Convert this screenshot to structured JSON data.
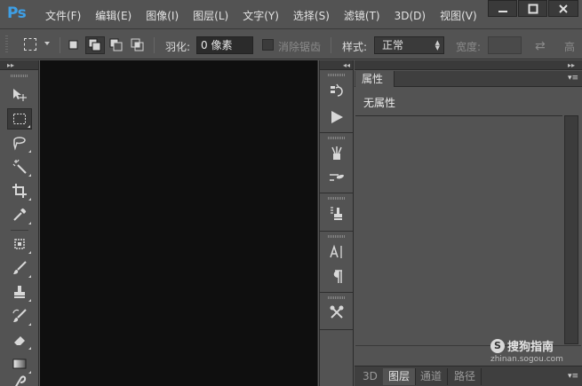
{
  "app": {
    "logo": "Ps"
  },
  "menu": [
    {
      "label": "文件(F)"
    },
    {
      "label": "编辑(E)"
    },
    {
      "label": "图像(I)"
    },
    {
      "label": "图层(L)"
    },
    {
      "label": "文字(Y)"
    },
    {
      "label": "选择(S)"
    },
    {
      "label": "滤镜(T)"
    },
    {
      "label": "3D(D)"
    },
    {
      "label": "视图(V)"
    }
  ],
  "window_controls": {
    "minimize": "—",
    "maximize": "□",
    "close": "✕"
  },
  "options_bar": {
    "feather_label": "羽化:",
    "feather_value": "0 像素",
    "antialias_label": "消除锯齿",
    "style_label": "样式:",
    "style_value": "正常",
    "width_label": "宽度:",
    "height_label": "高"
  },
  "tools": [
    {
      "icon": "move-icon"
    },
    {
      "icon": "rectangular-marquee-icon",
      "active": true
    },
    {
      "icon": "lasso-icon"
    },
    {
      "icon": "magic-wand-icon"
    },
    {
      "icon": "crop-icon"
    },
    {
      "icon": "eyedropper-icon"
    },
    {
      "icon": "spot-healing-brush-icon"
    },
    {
      "icon": "brush-icon"
    },
    {
      "icon": "clone-stamp-icon"
    },
    {
      "icon": "history-brush-icon"
    },
    {
      "icon": "eraser-icon"
    },
    {
      "icon": "gradient-icon"
    },
    {
      "icon": "smudge-icon"
    }
  ],
  "mini_panels": [
    {
      "icon": "history-panel-icon"
    },
    {
      "icon": "actions-play-icon"
    },
    {
      "icon": "brush-presets-icon"
    },
    {
      "icon": "brush-settings-icon"
    },
    {
      "icon": "clone-source-icon"
    },
    {
      "icon": "character-panel-icon"
    },
    {
      "icon": "paragraph-panel-icon"
    },
    {
      "icon": "tool-presets-icon"
    }
  ],
  "properties_panel": {
    "tab_label": "属性",
    "no_properties_text": "无属性"
  },
  "bottom_tabs": [
    {
      "label": "3D",
      "active": false
    },
    {
      "label": "图层",
      "active": true
    },
    {
      "label": "通道",
      "active": false
    },
    {
      "label": "路径",
      "active": false
    }
  ],
  "watermark": {
    "brand": "搜狗指南",
    "url": "zhinan.sogou.com"
  }
}
